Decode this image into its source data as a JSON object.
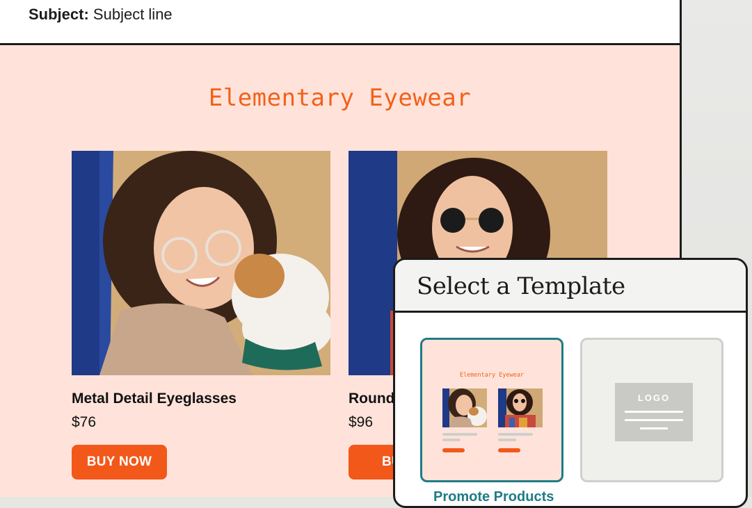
{
  "email": {
    "subject_label": "Subject:",
    "subject_value": "Subject line",
    "brand": "Elementary Eyewear",
    "products": [
      {
        "name": "Metal Detail Eyeglasses",
        "price": "$76",
        "button": "BUY NOW"
      },
      {
        "name": "Round",
        "price": "$96",
        "button": "BUY"
      }
    ]
  },
  "modal": {
    "title": "Select a Template",
    "templates": [
      {
        "mini_brand": "Elementary Eyewear",
        "caption": "Promote Products",
        "selected": true
      },
      {
        "logo_text": "LOGO"
      }
    ]
  },
  "colors": {
    "accent_orange": "#f2581a",
    "email_bg": "#ffe3da",
    "selected_teal": "#1e7c85"
  }
}
